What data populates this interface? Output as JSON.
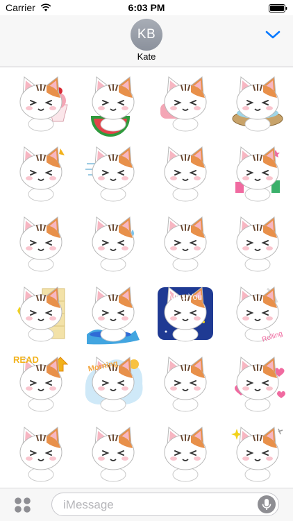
{
  "status_bar": {
    "carrier": "Carrier",
    "time": "6:03 PM"
  },
  "header": {
    "avatar_initials": "KB",
    "contact_name": "Kate"
  },
  "stickers": [
    {
      "id": "kitty-shaved-ice",
      "accent": "#f4a6b5",
      "prop": "ice"
    },
    {
      "id": "kitty-watermelon",
      "accent": "#e3434a",
      "prop": "melon"
    },
    {
      "id": "kitty-lying-pillow",
      "accent": "#f4a6b5",
      "prop": "pillow"
    },
    {
      "id": "kitty-bath-tub",
      "accent": "#c8a36a",
      "prop": "tub"
    },
    {
      "id": "kitty-crying",
      "accent": "#7cc4ec",
      "prop": "tears"
    },
    {
      "id": "kitty-running",
      "accent": "#b0b0b0",
      "prop": "run"
    },
    {
      "id": "kitty-red-mask",
      "accent": "#e3434a",
      "prop": "mask"
    },
    {
      "id": "kitty-shopping",
      "accent": "#f06aa0",
      "prop": "bags"
    },
    {
      "id": "kitty-head-tilt",
      "accent": "#f4a6b5",
      "prop": "none"
    },
    {
      "id": "kitty-nervous",
      "accent": "#f4a6b5",
      "prop": "sweat"
    },
    {
      "id": "kitty-thinking",
      "accent": "#f4a6b5",
      "prop": "none"
    },
    {
      "id": "kitty-mask-running",
      "accent": "#e3434a",
      "prop": "mask"
    },
    {
      "id": "kitty-peeking-wall",
      "accent": "#f3e2a8",
      "prop": "wall"
    },
    {
      "id": "kitty-surfing",
      "accent": "#42a5e0",
      "prop": "wave"
    },
    {
      "id": "kitty-miss-you",
      "accent": "#1f3a93",
      "prop": "night"
    },
    {
      "id": "kitty-rolling",
      "accent": "#f06aa0",
      "prop": "rolling"
    },
    {
      "id": "kitty-read",
      "accent": "#f2b21b",
      "prop": "read"
    },
    {
      "id": "kitty-morning",
      "accent": "#7cc4ec",
      "prop": "morning"
    },
    {
      "id": "kitty-drinking",
      "accent": "#f2a33a",
      "prop": "cup"
    },
    {
      "id": "kitty-hearts",
      "accent": "#f06aa0",
      "prop": "hearts"
    },
    {
      "id": "kitty-smirk",
      "accent": "#f4a6b5",
      "prop": "none"
    },
    {
      "id": "kitty-sitting",
      "accent": "#b0b0b0",
      "prop": "none"
    },
    {
      "id": "kitty-pondering",
      "accent": "#f4a6b5",
      "prop": "none"
    },
    {
      "id": "kitty-clapping",
      "accent": "#f2d21b",
      "prop": "sparkle"
    }
  ],
  "sticker_texts": {
    "miss_you": "Miss You",
    "rolling": "Rolling",
    "read": "READ",
    "morning": "Morning"
  },
  "input_bar": {
    "placeholder": "iMessage"
  },
  "colors": {
    "accent_blue": "#0a7aff",
    "avatar_gray": "#9aa0a9",
    "fur_orange": "#e8904a",
    "fur_dark": "#6b4a33"
  },
  "icons": [
    "wifi-icon",
    "battery-icon",
    "chevron-down-icon",
    "app-drawer-icon",
    "microphone-icon"
  ]
}
